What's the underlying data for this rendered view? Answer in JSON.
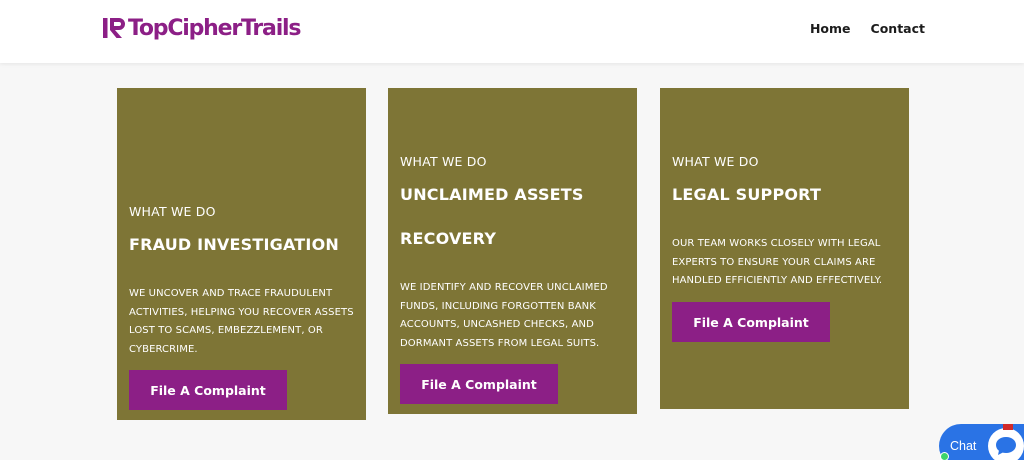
{
  "brand": {
    "logo_text": "TopCipherTrails",
    "color": "#8c1f86"
  },
  "nav": {
    "home": "Home",
    "contact": "Contact"
  },
  "cards": [
    {
      "eyebrow": "WHAT WE DO",
      "title_lines": [
        "FRAUD INVESTIGATION"
      ],
      "body_lines": [
        "WE UNCOVER AND TRACE FRAUDULENT",
        "ACTIVITIES, HELPING YOU RECOVER ASSETS",
        "LOST TO SCAMS, EMBEZZLEMENT, OR",
        "CYBERCRIME."
      ],
      "button": "File A Complaint"
    },
    {
      "eyebrow": "WHAT WE DO",
      "title_lines": [
        "UNCLAIMED ASSETS",
        "RECOVERY"
      ],
      "body_lines": [
        "WE IDENTIFY AND RECOVER UNCLAIMED",
        "FUNDS, INCLUDING FORGOTTEN BANK",
        "ACCOUNTS, UNCASHED CHECKS, AND",
        "DORMANT ASSETS FROM LEGAL SUITS."
      ],
      "button": "File A Complaint"
    },
    {
      "eyebrow": "WHAT WE DO",
      "title_lines": [
        "LEGAL SUPPORT"
      ],
      "body_lines": [
        "OUR TEAM WORKS CLOSELY WITH LEGAL",
        "EXPERTS TO ENSURE YOUR CLAIMS ARE",
        "HANDLED EFFICIENTLY AND EFFECTIVELY."
      ],
      "button": "File A Complaint"
    }
  ],
  "chat": {
    "label": "Chat",
    "icon": "chat-bubble-icon"
  },
  "colors": {
    "card_bg": "#7e7536",
    "button_bg": "#8c1f86",
    "chat_bg": "#2a73e5"
  }
}
